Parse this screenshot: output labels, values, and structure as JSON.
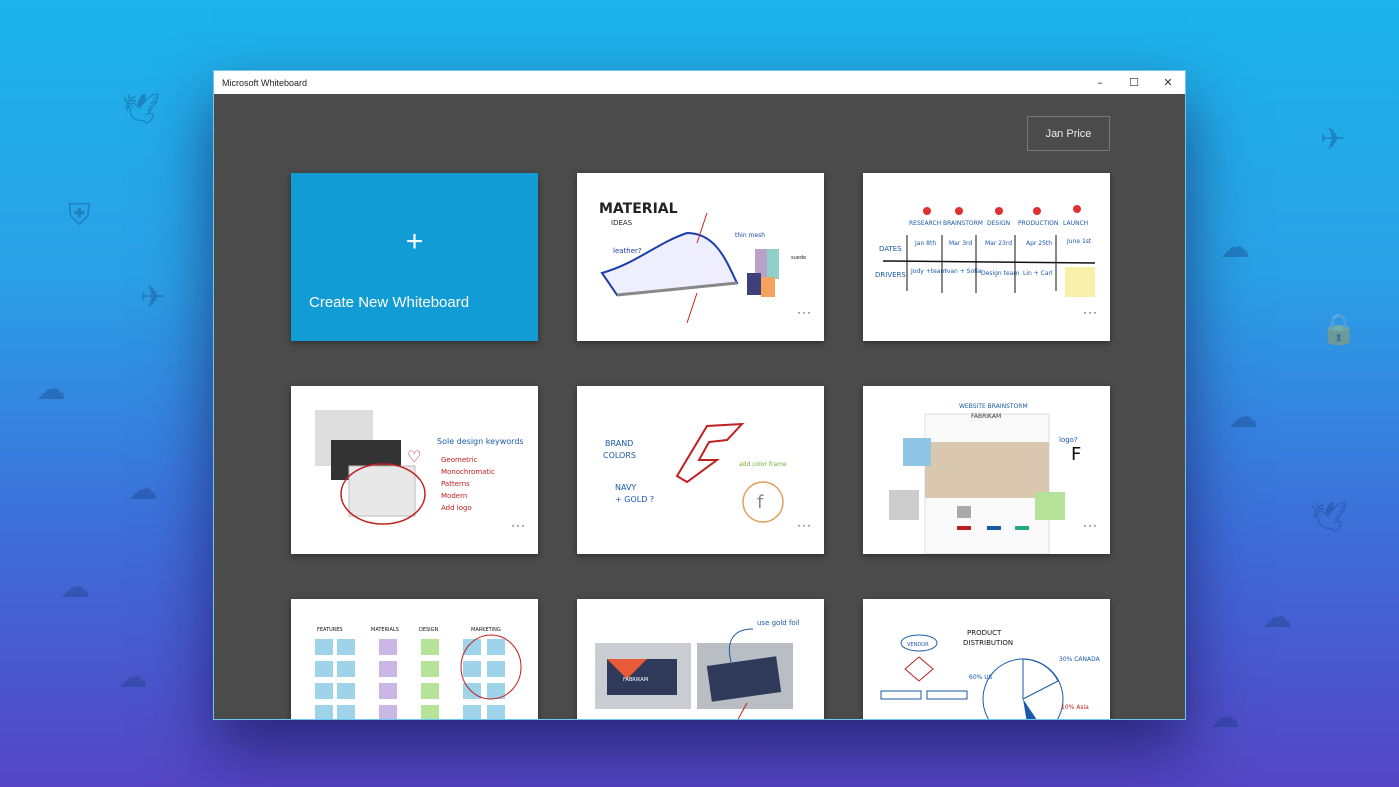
{
  "window": {
    "title": "Microsoft Whiteboard",
    "minimize": "–",
    "maximize": "☐",
    "close": "✕"
  },
  "user": {
    "name": "Jan Price"
  },
  "create": {
    "icon": "+",
    "label": "Create New Whiteboard"
  },
  "more_label": "···",
  "boards": [
    {
      "t1": "MATERIAL",
      "t2": "IDEAS",
      "t3": "leather?",
      "t4": "thin mesh",
      "t5": "suede"
    },
    {
      "stages": [
        "RESEARCH",
        "BRAINSTORM",
        "DESIGN",
        "PRODUCTION",
        "LAUNCH"
      ],
      "rows": [
        "DATES",
        "DRIVERS"
      ],
      "dates": [
        "Jan 8th",
        "Mar 3rd",
        "Mar 23rd",
        "Apr 25th",
        "June 1st"
      ],
      "drivers": [
        "Jody +team",
        "Ivan + Sofia",
        "Design team",
        "Lin + Carl"
      ]
    },
    {
      "title": "Sole design keywords",
      "items": [
        "Geometric",
        "Monochromatic",
        "Patterns",
        "Modern",
        "Add logo"
      ]
    },
    {
      "t1": "BRAND",
      "t2": "COLORS",
      "t3": "NAVY",
      "t4": "+ GOLD ?",
      "t5": "add color frame"
    },
    {
      "t1": "WEBSITE BRAINSTORM",
      "t2": "FABRIKAM",
      "t3": "logo?"
    },
    {
      "cols": [
        "FEATURES",
        "MATERIALS",
        "DESIGN",
        "MARKETING"
      ]
    },
    {
      "t1": "use gold foil",
      "t2": "FABRIKAM"
    },
    {
      "t1": "PRODUCT",
      "t2": "DISTRIBUTION",
      "t3": "VENDOR",
      "t4": "30% CANADA",
      "t5": "60% US",
      "t6": "10% Asia"
    }
  ],
  "colors": {
    "accent": "#129cd6",
    "canvas": "#4b4b4b"
  }
}
